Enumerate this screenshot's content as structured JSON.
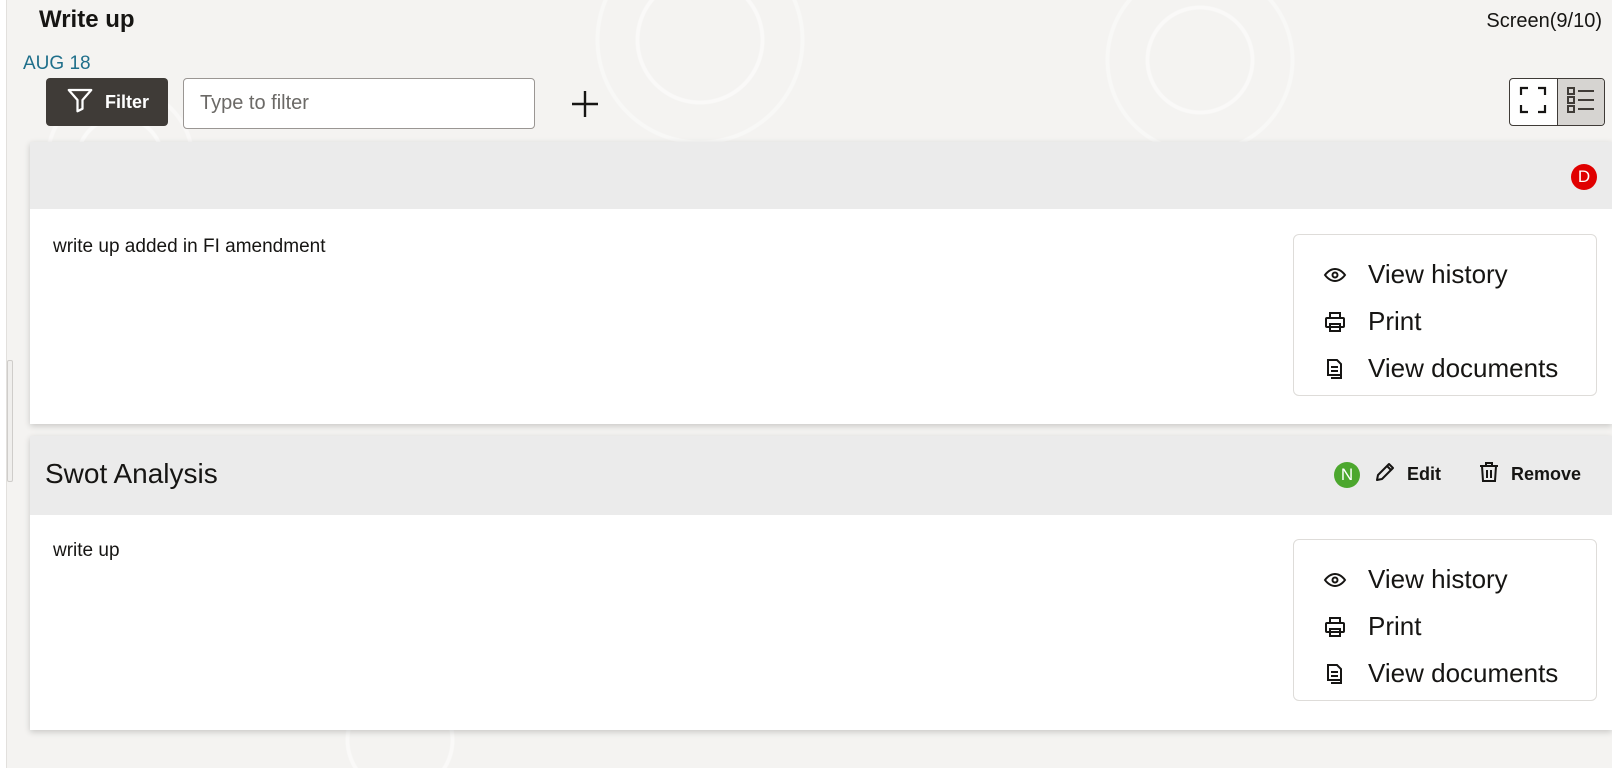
{
  "header": {
    "title": "Write up",
    "screen_counter": "Screen(9/10)",
    "date": "AUG 18"
  },
  "toolbar": {
    "filter_label": "Filter",
    "filter_placeholder": "Type to filter",
    "add_icon": "plus-icon",
    "view_toggle": [
      "fullscreen-icon",
      "list-view-icon"
    ]
  },
  "cards": [
    {
      "title": "",
      "badge": "D",
      "badge_color": "#e00000",
      "body": "write up added in FI amendment",
      "menu": [
        "View history",
        "Print",
        "View documents"
      ]
    },
    {
      "title": "Swot Analysis",
      "badge": "N",
      "badge_color": "#4ca72e",
      "edit_label": "Edit",
      "remove_label": "Remove",
      "body": "write up",
      "menu": [
        "View history",
        "Print",
        "View documents"
      ]
    }
  ],
  "colors": {
    "filter_button": "#3f3b37",
    "date_link": "#1f6f8b",
    "card_header": "#ebebeb"
  }
}
